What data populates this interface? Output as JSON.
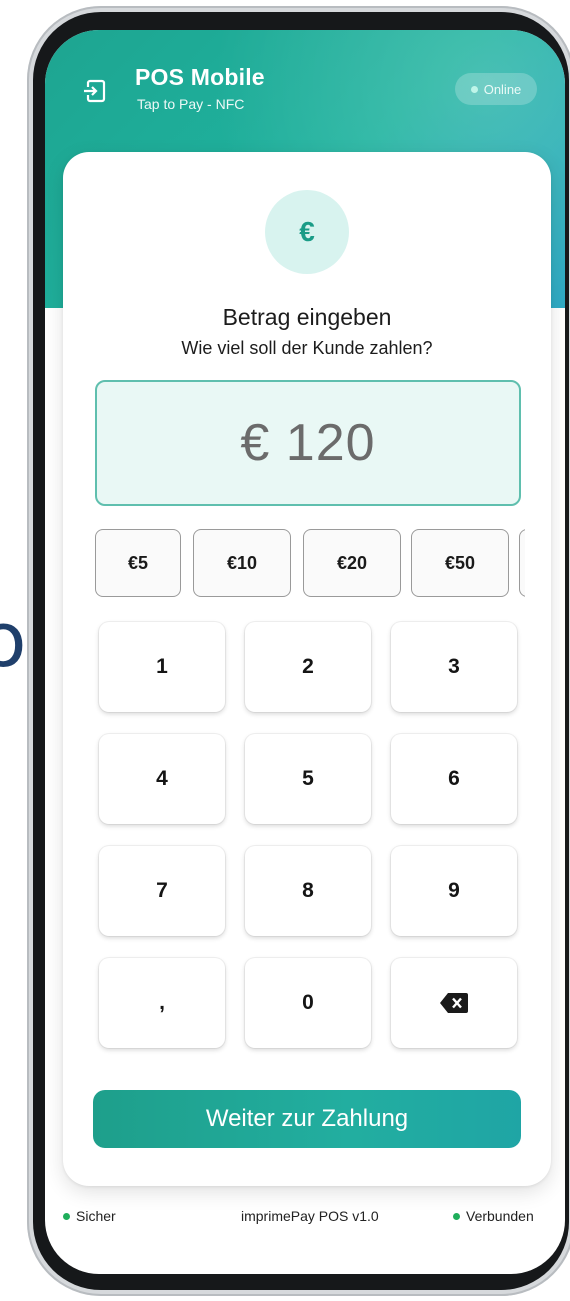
{
  "background": {
    "fragment_text": "or"
  },
  "header": {
    "title": "POS Mobile",
    "subtitle": "Tap to Pay - NFC",
    "status": "Online",
    "icon": "login-icon"
  },
  "card": {
    "currency_symbol": "€",
    "title": "Betrag eingeben",
    "subtitle": "Wie viel soll der Kunde zahlen?",
    "amount_display": "€ 120",
    "presets": [
      "€5",
      "€10",
      "€20",
      "€50"
    ],
    "keypad": {
      "keys": [
        "1",
        "2",
        "3",
        "4",
        "5",
        "6",
        "7",
        "8",
        "9",
        ",",
        "0"
      ],
      "backspace_icon": "backspace-icon"
    },
    "cta_label": "Weiter zur Zahlung"
  },
  "footer": {
    "left": "Sicher",
    "center": "imprimePay POS v1.0",
    "right": "Verbunden"
  },
  "colors": {
    "accent": "#1ea591",
    "status_green": "#1fae5b"
  }
}
